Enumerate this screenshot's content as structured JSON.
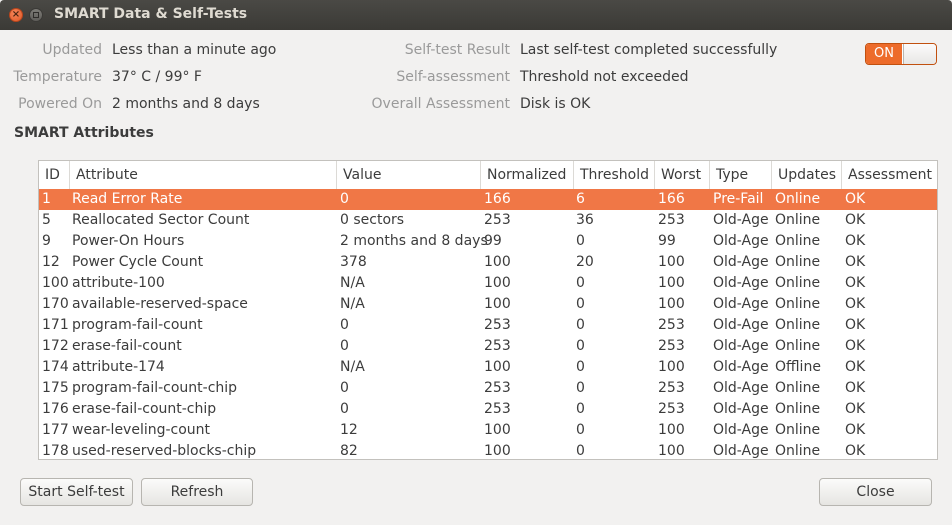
{
  "window": {
    "title": "SMART Data & Self-Tests",
    "close_glyph": "×"
  },
  "info": {
    "updated_label": "Updated",
    "updated_value": "Less than a minute ago",
    "temperature_label": "Temperature",
    "temperature_value": "37° C / 99° F",
    "powered_on_label": "Powered On",
    "powered_on_value": "2 months and 8 days",
    "selftest_label": "Self-test Result",
    "selftest_value": "Last self-test completed successfully",
    "selfassessment_label": "Self-assessment",
    "selfassessment_value": "Threshold not exceeded",
    "overall_label": "Overall Assessment",
    "overall_value": "Disk is OK"
  },
  "toggle": {
    "label": "ON",
    "state": "on",
    "accent": "#ed6b2a"
  },
  "section": {
    "title": "SMART Attributes"
  },
  "table": {
    "columns": [
      "ID",
      "Attribute",
      "Value",
      "Normalized",
      "Threshold",
      "Worst",
      "Type",
      "Updates",
      "Assessment"
    ],
    "rows": [
      [
        "1",
        "Read Error Rate",
        "0",
        "166",
        "6",
        "166",
        "Pre-Fail",
        "Online",
        "OK"
      ],
      [
        "5",
        "Reallocated Sector Count",
        "0 sectors",
        "253",
        "36",
        "253",
        "Old-Age",
        "Online",
        "OK"
      ],
      [
        "9",
        "Power-On Hours",
        "2 months and 8 days",
        "99",
        "0",
        "99",
        "Old-Age",
        "Online",
        "OK"
      ],
      [
        "12",
        "Power Cycle Count",
        "378",
        "100",
        "20",
        "100",
        "Old-Age",
        "Online",
        "OK"
      ],
      [
        "100",
        "attribute-100",
        "N/A",
        "100",
        "0",
        "100",
        "Old-Age",
        "Online",
        "OK"
      ],
      [
        "170",
        "available-reserved-space",
        "N/A",
        "100",
        "0",
        "100",
        "Old-Age",
        "Online",
        "OK"
      ],
      [
        "171",
        "program-fail-count",
        "0",
        "253",
        "0",
        "253",
        "Old-Age",
        "Online",
        "OK"
      ],
      [
        "172",
        "erase-fail-count",
        "0",
        "253",
        "0",
        "253",
        "Old-Age",
        "Online",
        "OK"
      ],
      [
        "174",
        "attribute-174",
        "N/A",
        "100",
        "0",
        "100",
        "Old-Age",
        "Offline",
        "OK"
      ],
      [
        "175",
        "program-fail-count-chip",
        "0",
        "253",
        "0",
        "253",
        "Old-Age",
        "Online",
        "OK"
      ],
      [
        "176",
        "erase-fail-count-chip",
        "0",
        "253",
        "0",
        "253",
        "Old-Age",
        "Online",
        "OK"
      ],
      [
        "177",
        "wear-leveling-count",
        "12",
        "100",
        "0",
        "100",
        "Old-Age",
        "Online",
        "OK"
      ],
      [
        "178",
        "used-reserved-blocks-chip",
        "82",
        "100",
        "0",
        "100",
        "Old-Age",
        "Online",
        "OK"
      ]
    ],
    "selected_row": 0,
    "selection_color": "#f07746"
  },
  "buttons": {
    "start_selftest": "Start Self-test",
    "refresh": "Refresh",
    "close": "Close"
  }
}
